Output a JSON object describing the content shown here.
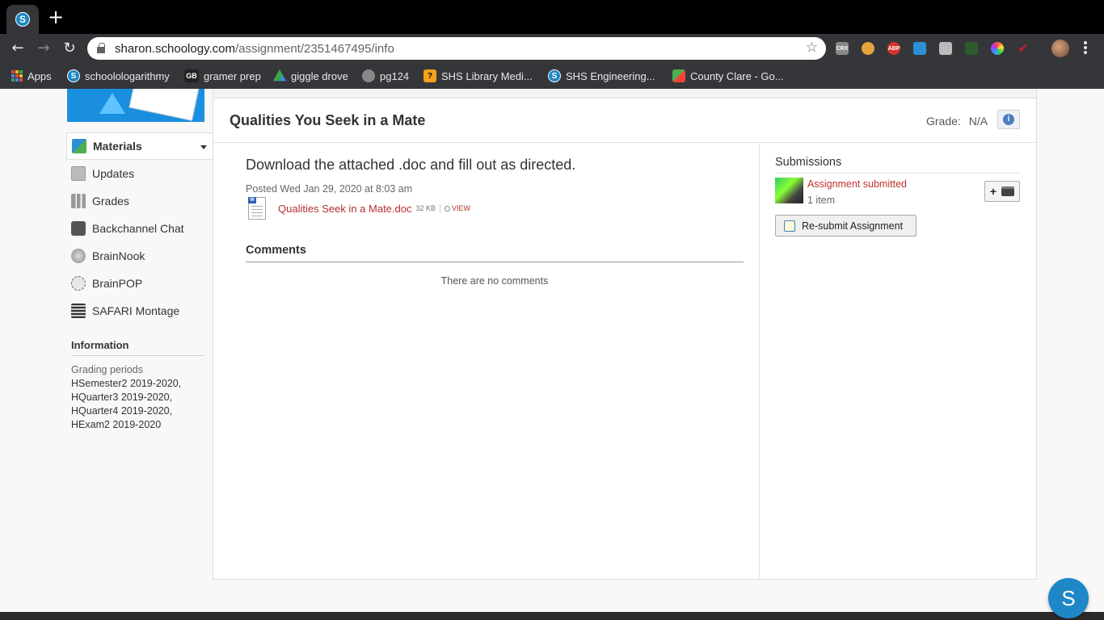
{
  "browser": {
    "tab_favicon": "S",
    "new_tab_label": "+",
    "url_host": "sharon.schoology.com",
    "url_path": "/assignment/2351467495/info",
    "extensions": [
      {
        "name": "crx-icon",
        "label": "CRX",
        "color": "#888888"
      },
      {
        "name": "owl-icon",
        "label": "",
        "color": "#e8a33b"
      },
      {
        "name": "adblock-icon",
        "label": "ABP",
        "color": "#d4342b"
      },
      {
        "name": "check-icon",
        "label": "",
        "color": "#2d8fd5"
      },
      {
        "name": "briefcase-icon",
        "label": "",
        "color": "#bbbbbb"
      },
      {
        "name": "leaf-icon",
        "label": "",
        "color": "#2e5b2e"
      },
      {
        "name": "color-wheel-icon",
        "label": "",
        "color": "#9b3fd0"
      },
      {
        "name": "red-check-icon",
        "label": "",
        "color": "#d21f2f"
      }
    ]
  },
  "bookmarks": [
    {
      "name": "apps",
      "label": "Apps",
      "icon_color": ""
    },
    {
      "name": "schoolologarithmy",
      "label": "schoolologarithmy",
      "icon_text": "S",
      "icon_color": "#1e88c7"
    },
    {
      "name": "gramer-prep",
      "label": "gramer prep",
      "icon_text": "GB",
      "icon_color": "#222222"
    },
    {
      "name": "giggle-drove",
      "label": "giggle drove",
      "icon_text": "",
      "icon_color": "#34a853"
    },
    {
      "name": "pg124",
      "label": "pg124",
      "icon_text": "",
      "icon_color": "#888888"
    },
    {
      "name": "shs-library",
      "label": "SHS Library Medi...",
      "icon_text": "?",
      "icon_color": "#f4a21b"
    },
    {
      "name": "shs-engineering",
      "label": "SHS Engineering...",
      "icon_text": "S",
      "icon_color": "#1e88c7"
    },
    {
      "name": "county-clare",
      "label": "County Clare - Go...",
      "icon_text": "",
      "icon_color": "#4caf50"
    }
  ],
  "sidebar": {
    "items": [
      {
        "label": "Materials",
        "icon": "materials-icon",
        "active": true
      },
      {
        "label": "Updates",
        "icon": "updates-icon",
        "active": false
      },
      {
        "label": "Grades",
        "icon": "grades-icon",
        "active": false
      },
      {
        "label": "Backchannel Chat",
        "icon": "chat-icon",
        "active": false
      },
      {
        "label": "BrainNook",
        "icon": "brainnook-icon",
        "active": false
      },
      {
        "label": "BrainPOP",
        "icon": "brainpop-icon",
        "active": false
      },
      {
        "label": "SAFARI Montage",
        "icon": "safari-montage-icon",
        "active": false
      }
    ],
    "info_heading": "Information",
    "grading_label": "Grading periods",
    "grading_periods": "HSemester2 2019-2020, HQuarter3 2019-2020, HQuarter4 2019-2020, HExam2 2019-2020",
    "grading_lines": [
      "HSemester2 2019-2020,",
      "HQuarter3 2019-2020,",
      "HQuarter4 2019-2020,",
      "HExam2 2019-2020"
    ]
  },
  "assignment": {
    "title": "Qualities You Seek in a Mate",
    "grade_label": "Grade:",
    "grade_value": "N/A",
    "description": "Download the attached .doc and fill out as directed.",
    "posted": "Posted Wed Jan 29, 2020 at 8:03 am",
    "attachment": {
      "filename": "Qualities Seek in a Mate.doc",
      "size": "32 KB",
      "view_label": "VIEW"
    },
    "comments_heading": "Comments",
    "no_comments": "There are no comments"
  },
  "submissions": {
    "heading": "Submissions",
    "status": "Assignment submitted",
    "count": "1 item",
    "resubmit_label": "Re-submit Assignment"
  },
  "help": {
    "label": "S"
  },
  "colors": {
    "accent": "#1e88c7",
    "link": "#b52e2e"
  }
}
